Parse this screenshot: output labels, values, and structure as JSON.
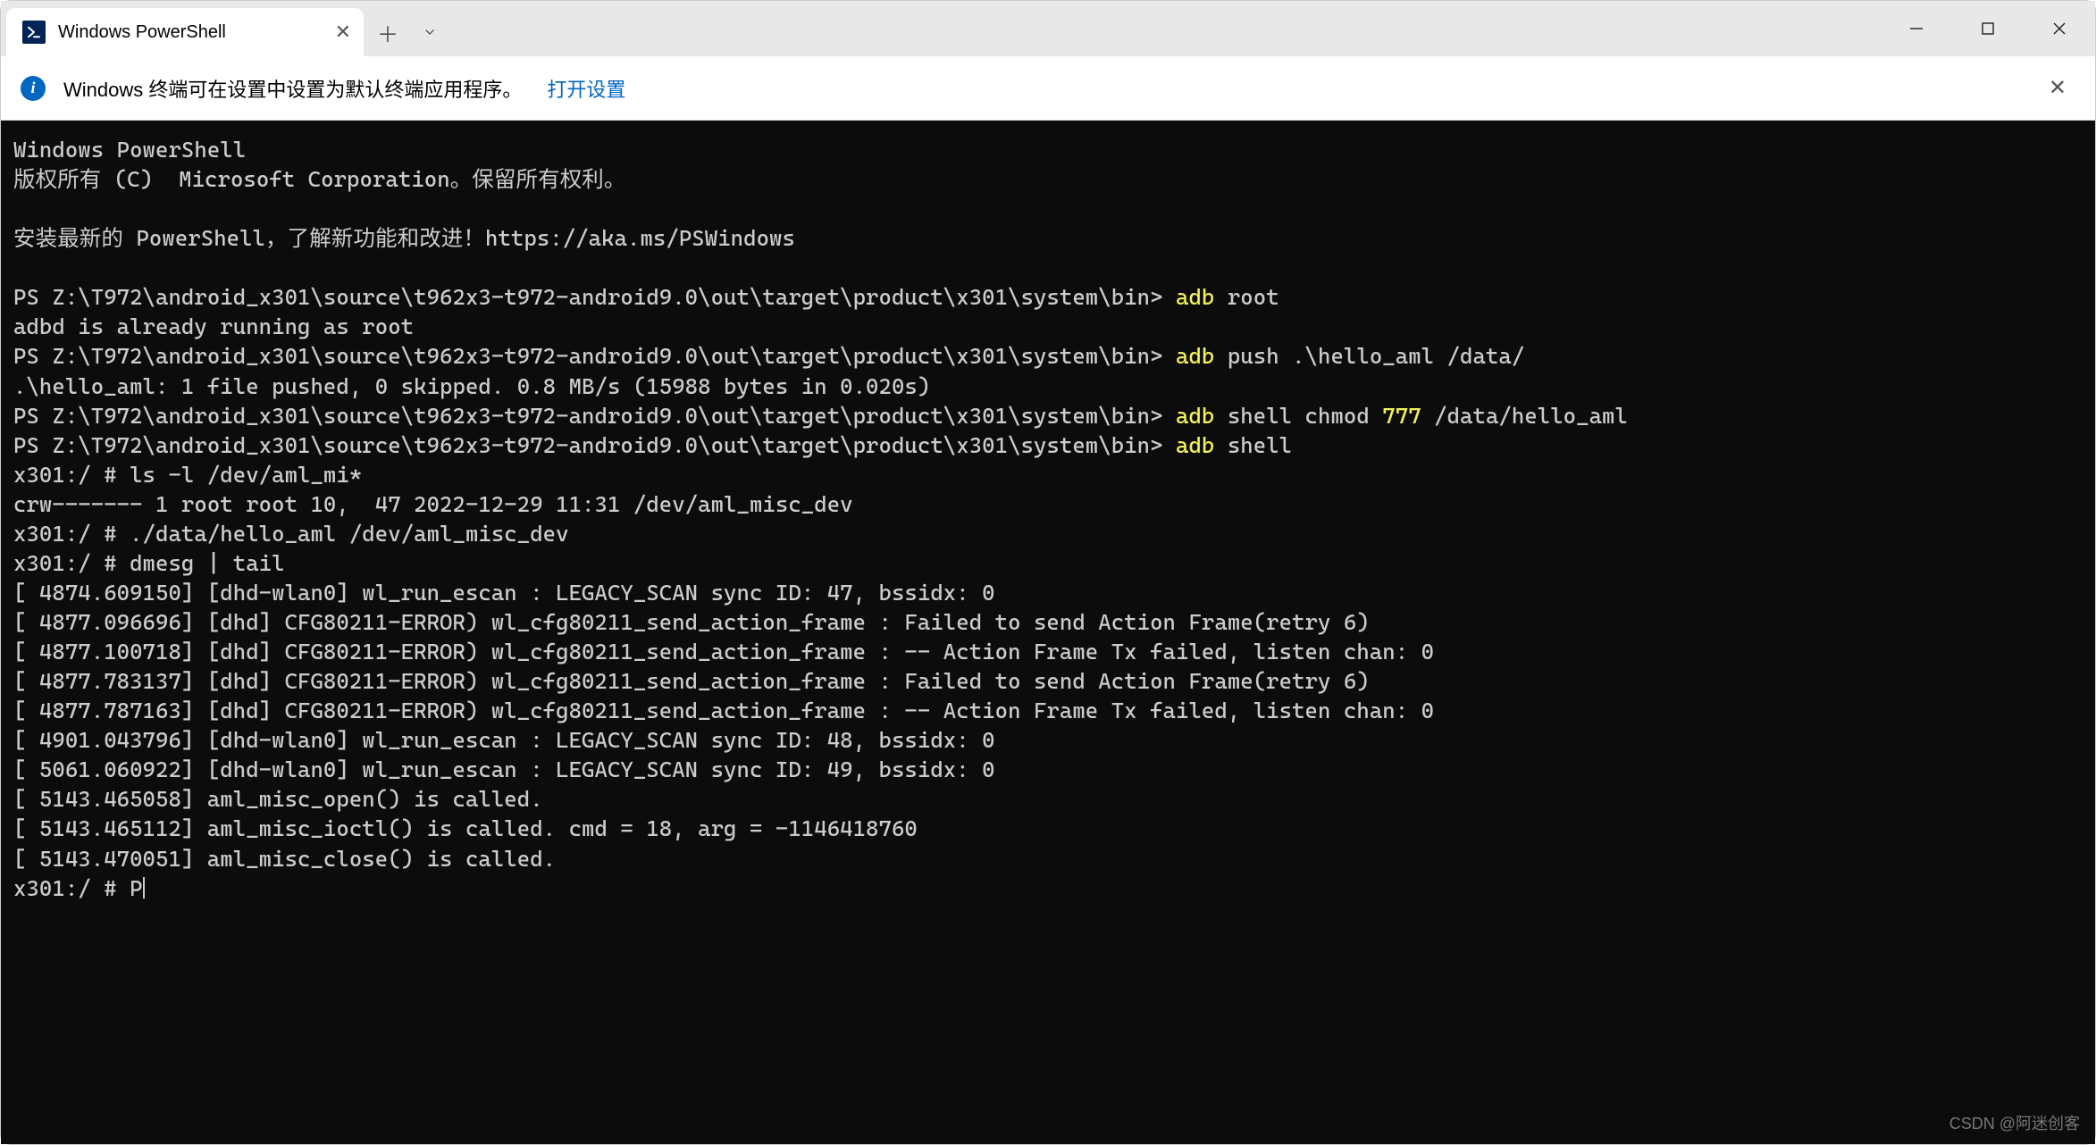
{
  "tab": {
    "title": "Windows PowerShell"
  },
  "infobar": {
    "text": "Windows 终端可在设置中设置为默认终端应用程序。",
    "link": "打开设置"
  },
  "term": {
    "l0": "Windows PowerShell",
    "l1": "版权所有 (C)  Microsoft Corporation。保留所有权利。",
    "l2": "安装最新的 PowerShell，了解新功能和改进！https://aka.ms/PSWindows",
    "p1": "PS Z:\\T972\\android_x301\\source\\t962x3-t972-android9.0\\out\\target\\product\\x301\\system\\bin> ",
    "c1a": "adb ",
    "c1b": "root",
    "l3": "adbd is already running as root",
    "p2": "PS Z:\\T972\\android_x301\\source\\t962x3-t972-android9.0\\out\\target\\product\\x301\\system\\bin> ",
    "c2a": "adb ",
    "c2b": "push .\\hello_aml /data/",
    "l4": ".\\hello_aml: 1 file pushed, 0 skipped. 0.8 MB/s (15988 bytes in 0.020s)",
    "p3": "PS Z:\\T972\\android_x301\\source\\t962x3-t972-android9.0\\out\\target\\product\\x301\\system\\bin> ",
    "c3a": "adb ",
    "c3b": "shell chmod ",
    "c3c": "777 ",
    "c3d": "/data/hello_aml",
    "p4": "PS Z:\\T972\\android_x301\\source\\t962x3-t972-android9.0\\out\\target\\product\\x301\\system\\bin> ",
    "c4a": "adb ",
    "c4b": "shell",
    "l5": "x301:/ # ls -l /dev/aml_mi*",
    "l6": "crw------- 1 root root 10,  47 2022-12-29 11:31 /dev/aml_misc_dev",
    "l7": "x301:/ # ./data/hello_aml /dev/aml_misc_dev",
    "l8": "x301:/ # dmesg | tail",
    "l9": "[ 4874.609150] [dhd-wlan0] wl_run_escan : LEGACY_SCAN sync ID: 47, bssidx: 0",
    "l10": "[ 4877.096696] [dhd] CFG80211-ERROR) wl_cfg80211_send_action_frame : Failed to send Action Frame(retry 6)",
    "l11": "[ 4877.100718] [dhd] CFG80211-ERROR) wl_cfg80211_send_action_frame : -- Action Frame Tx failed, listen chan: 0",
    "l12": "[ 4877.783137] [dhd] CFG80211-ERROR) wl_cfg80211_send_action_frame : Failed to send Action Frame(retry 6)",
    "l13": "[ 4877.787163] [dhd] CFG80211-ERROR) wl_cfg80211_send_action_frame : -- Action Frame Tx failed, listen chan: 0",
    "l14": "[ 4901.043796] [dhd-wlan0] wl_run_escan : LEGACY_SCAN sync ID: 48, bssidx: 0",
    "l15": "[ 5061.060922] [dhd-wlan0] wl_run_escan : LEGACY_SCAN sync ID: 49, bssidx: 0",
    "l16": "[ 5143.465058] aml_misc_open() is called.",
    "l17": "[ 5143.465112] aml_misc_ioctl() is called. cmd = 18, arg = -1146418760",
    "l18": "[ 5143.470051] aml_misc_close() is called.",
    "l19": "x301:/ # P"
  },
  "watermark": "CSDN @阿迷创客"
}
